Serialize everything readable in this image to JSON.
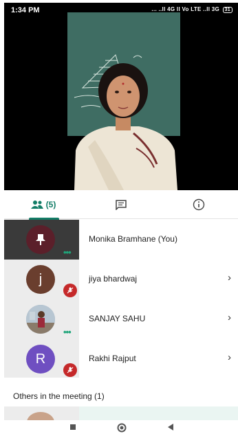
{
  "status_bar": {
    "time": "1:34 PM",
    "signal_text": "... ..ll 4G ll Vo LTE ..ll 3G",
    "battery": "31"
  },
  "tabs": [
    {
      "icon": "people-icon",
      "label": "(5)",
      "active": true
    },
    {
      "icon": "chat-icon",
      "label": "",
      "active": false
    },
    {
      "icon": "info-icon",
      "label": "",
      "active": false
    }
  ],
  "participants": [
    {
      "name": "Monika Bramhane (You)",
      "avatar": "pin-icon",
      "avatar_color": "#5b1f2a",
      "status": "speaking-dots",
      "chevron": false
    },
    {
      "name": "jiya bhardwaj",
      "avatar": "j",
      "avatar_color": "#6a3e2e",
      "status": "muted",
      "chevron": true
    },
    {
      "name": "SANJAY SAHU",
      "avatar": "photo",
      "avatar_color": "#8aa0b4",
      "status": "speaking-dots",
      "chevron": true
    },
    {
      "name": "Rakhi Rajput",
      "avatar": "R",
      "avatar_color": "#6f4fc1",
      "status": "muted",
      "chevron": true
    }
  ],
  "others_section": {
    "label": "Others in the meeting (1)"
  },
  "accent_color": "#137d67",
  "mute_color": "#c5292a"
}
